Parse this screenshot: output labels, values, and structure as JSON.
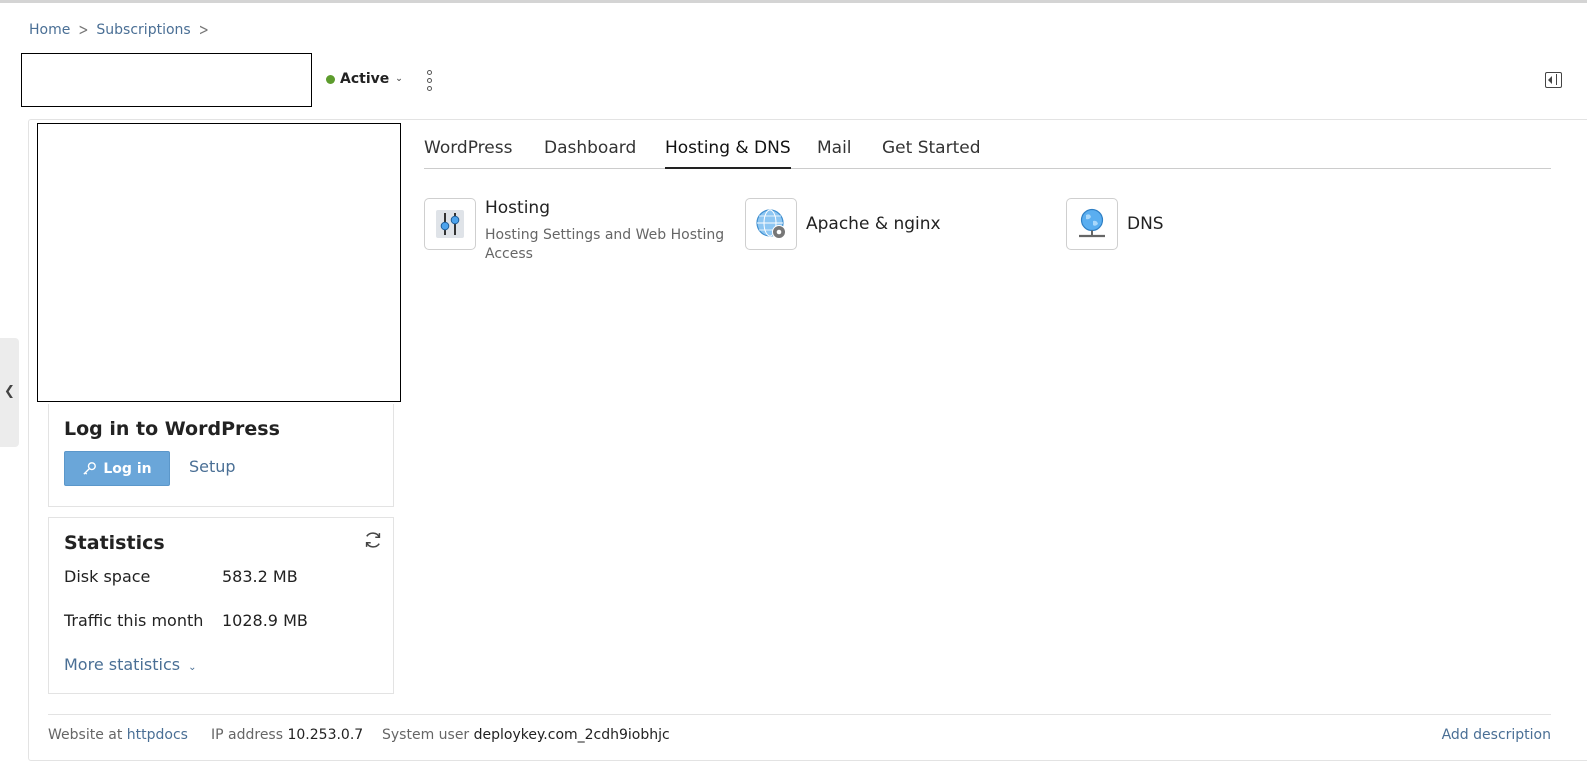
{
  "breadcrumb": {
    "home": "Home",
    "subscriptions": "Subscriptions",
    "separator": ">"
  },
  "subscription": {
    "status": "Active",
    "status_color": "#5d9c2d"
  },
  "login_widget": {
    "title": "Log in to WordPress",
    "login_label": "Log in",
    "setup_label": "Setup"
  },
  "statistics": {
    "title": "Statistics",
    "rows": [
      {
        "label": "Disk space",
        "value": "583.2 MB"
      },
      {
        "label": "Traffic this month",
        "value": "1028.9 MB"
      }
    ],
    "more_label": "More statistics"
  },
  "tabs": [
    {
      "label": "WordPress",
      "active": false
    },
    {
      "label": "Dashboard",
      "active": false
    },
    {
      "label": "Hosting & DNS",
      "active": true
    },
    {
      "label": "Mail",
      "active": false
    },
    {
      "label": "Get Started",
      "active": false
    }
  ],
  "tools": [
    {
      "name": "Hosting",
      "description": "Hosting Settings and Web Hosting Access",
      "icon": "sliders-icon"
    },
    {
      "name": "Apache & nginx",
      "description": "",
      "icon": "globe-gear-icon"
    },
    {
      "name": "DNS",
      "description": "",
      "icon": "globe-network-icon"
    }
  ],
  "footer": {
    "website_label": "Website at",
    "website_value": "httpdocs",
    "ip_label": "IP address",
    "ip_value": "10.253.0.7",
    "user_label": "System user",
    "user_value": "deploykey.com_2cdh9iobhjc",
    "add_description": "Add description"
  },
  "colors": {
    "accent": "#6aa6d9",
    "link": "#4a6f95",
    "status_active": "#5d9c2d"
  }
}
